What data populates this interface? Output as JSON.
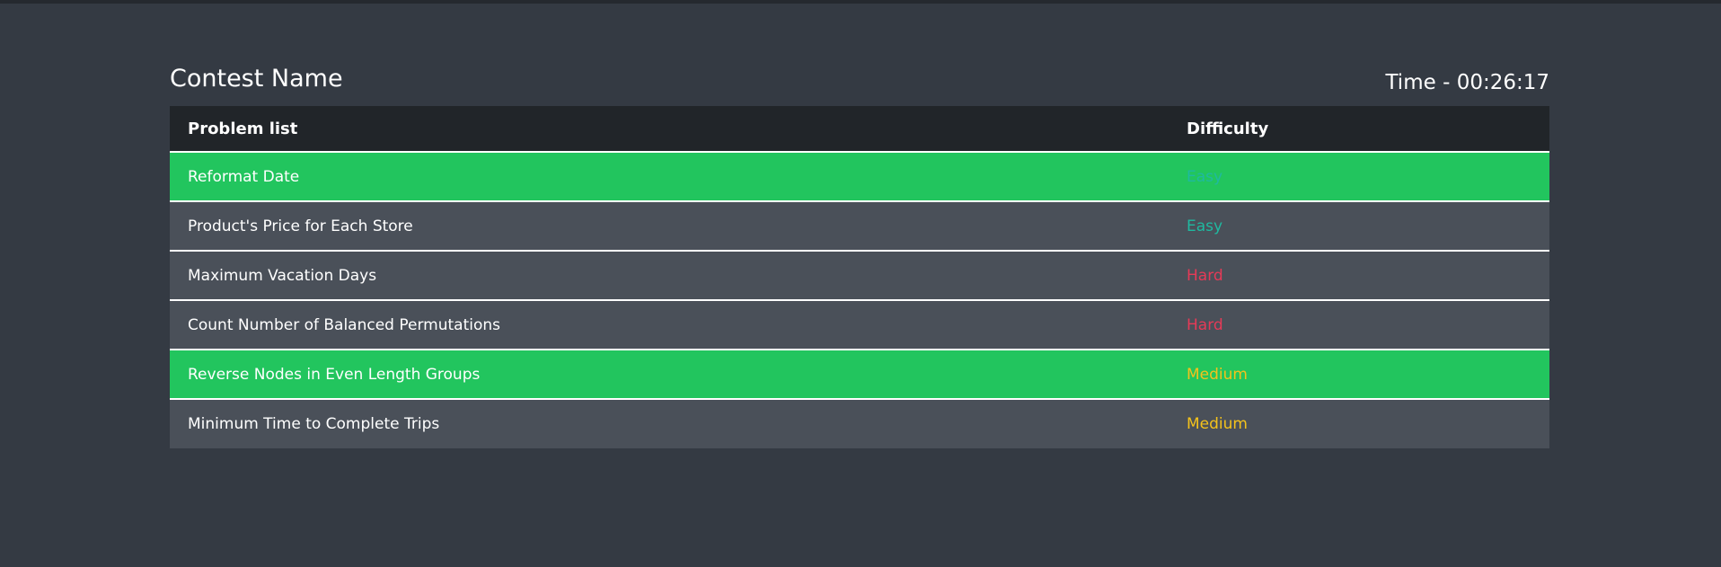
{
  "contest": {
    "name": "Contest Name",
    "timer_label": "Time",
    "timer_separator": " - ",
    "timer_value": "00:26:17"
  },
  "table": {
    "headers": [
      "Problem list",
      "Difficulty"
    ],
    "rows": [
      {
        "problem": "Reformat Date",
        "difficulty": "Easy",
        "status": "solved"
      },
      {
        "problem": "Product's Price for Each Store",
        "difficulty": "Easy",
        "status": "unsolved"
      },
      {
        "problem": "Maximum Vacation Days",
        "difficulty": "Hard",
        "status": "unsolved"
      },
      {
        "problem": "Count Number of Balanced Permutations",
        "difficulty": "Hard",
        "status": "unsolved"
      },
      {
        "problem": "Reverse Nodes in Even Length Groups",
        "difficulty": "Medium",
        "status": "solved"
      },
      {
        "problem": "Minimum Time to Complete Trips",
        "difficulty": "Medium",
        "status": "unsolved"
      }
    ]
  },
  "colors": {
    "background": "#343a43",
    "header_background": "#212529",
    "row_background": "#4a5059",
    "solved_row_background": "#22c55e",
    "easy": "#1fb9a0",
    "medium": "#f4c21b",
    "hard": "#e63a57"
  }
}
